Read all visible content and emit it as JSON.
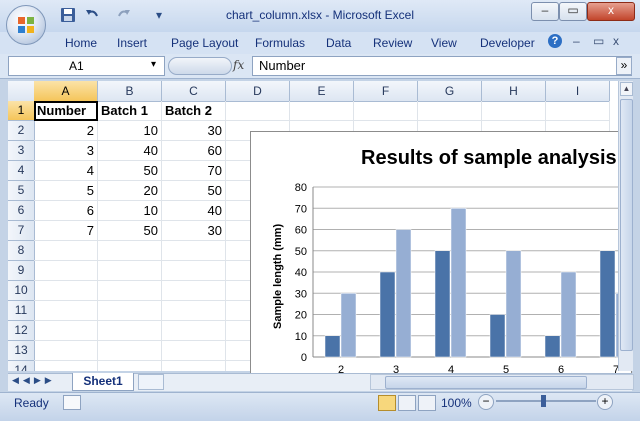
{
  "window": {
    "title": "chart_column.xlsx - Microsoft Excel",
    "controls": {
      "minimize": "–",
      "restore": "▭",
      "close": "x"
    },
    "qat_more": "▾"
  },
  "ribbon": {
    "tabs": [
      "Home",
      "Insert",
      "Page Layout",
      "Formulas",
      "Data",
      "Review",
      "View",
      "Developer"
    ],
    "help": "?",
    "expand": "»"
  },
  "formula_bar": {
    "name_box": "A1",
    "fx_label": "fx",
    "content": "Number"
  },
  "grid": {
    "columns": [
      "A",
      "B",
      "C",
      "D",
      "E",
      "F",
      "G",
      "H",
      "I"
    ],
    "rows": [
      "1",
      "2",
      "3",
      "4",
      "5",
      "6",
      "7",
      "8",
      "9",
      "10",
      "11",
      "12",
      "13",
      "14"
    ],
    "cells": [
      [
        "Number",
        "Batch 1",
        "Batch 2"
      ],
      [
        "2",
        "10",
        "30"
      ],
      [
        "3",
        "40",
        "60"
      ],
      [
        "4",
        "50",
        "70"
      ],
      [
        "5",
        "20",
        "50"
      ],
      [
        "6",
        "10",
        "40"
      ],
      [
        "7",
        "50",
        "30"
      ]
    ]
  },
  "chart_data": {
    "type": "bar",
    "title": "Results of sample analysis",
    "ylabel": "Sample length (mm)",
    "xlabel": "",
    "categories": [
      "2",
      "3",
      "4",
      "5",
      "6",
      "7"
    ],
    "series": [
      {
        "name": "Batch 1",
        "values": [
          10,
          40,
          50,
          20,
          10,
          50
        ],
        "color": "#4a73a8"
      },
      {
        "name": "Batch 2",
        "values": [
          30,
          60,
          70,
          50,
          40,
          30
        ],
        "color": "#96aed3"
      }
    ],
    "yticks": [
      "0",
      "10",
      "20",
      "30",
      "40",
      "50",
      "60",
      "70",
      "80"
    ],
    "ylim": [
      0,
      80
    ],
    "grid": true
  },
  "sheets": {
    "active": "Sheet1"
  },
  "status": {
    "ready": "Ready",
    "zoom": "100%",
    "zoom_out": "−",
    "zoom_in": "+"
  }
}
